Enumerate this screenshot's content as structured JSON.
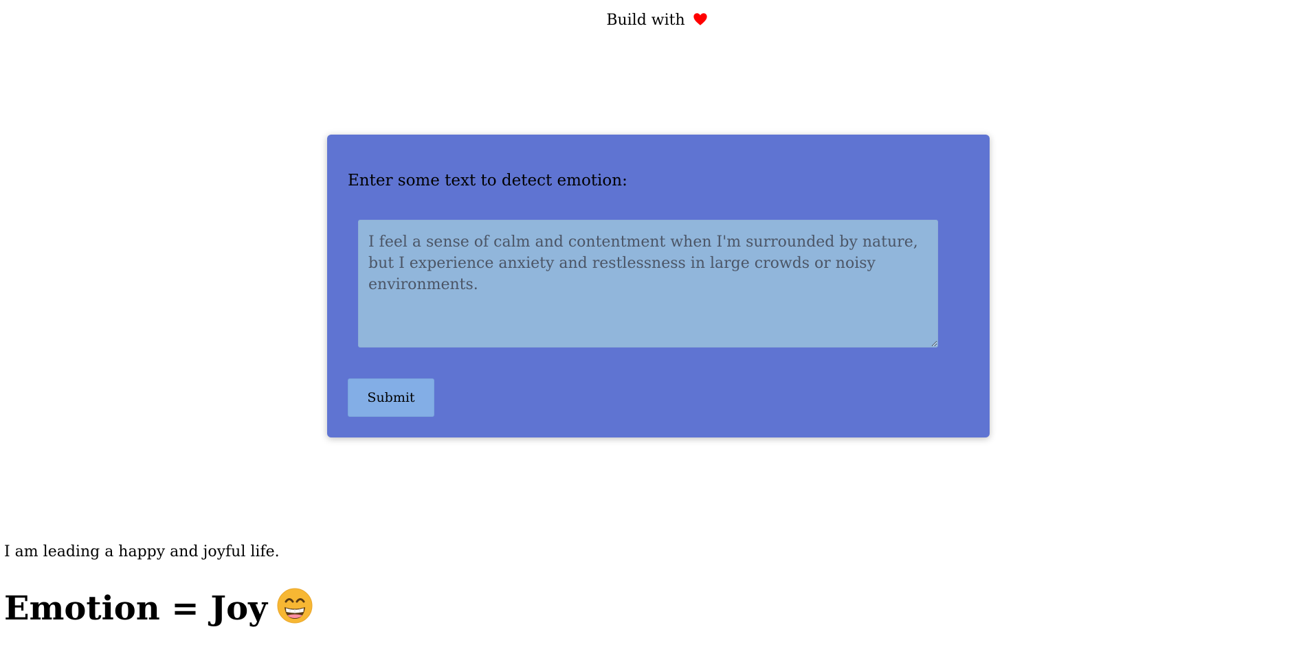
{
  "header": {
    "credit_text": "Build with",
    "heart_icon": "heart-icon",
    "heart_color": "#ff0000"
  },
  "form": {
    "label": "Enter some text to detect emotion:",
    "input_value": "",
    "input_placeholder": "I feel a sense of calm and contentment when I'm surrounded by nature, but I experience anxiety and restlessness in large crowds or noisy environments.",
    "submit_label": "Submit",
    "card_color": "#5f74d2",
    "input_color": "#91b6db",
    "button_color": "#83aee6"
  },
  "result": {
    "sentence": "I am leading a happy and joyful life.",
    "heading": "Emotion = Joy",
    "emoji_icon": "grinning-face-icon"
  }
}
